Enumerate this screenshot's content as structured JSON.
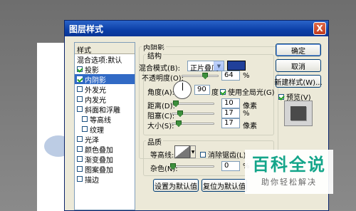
{
  "dialog": {
    "title": "图层样式",
    "close_glyph": "X"
  },
  "style_list": {
    "header": "样式",
    "items": [
      {
        "label": "混合选项:默认",
        "checkbox": false,
        "indent": false,
        "selected": false
      },
      {
        "label": "投影",
        "checkbox": true,
        "checked": true,
        "indent": false,
        "selected": false
      },
      {
        "label": "内阴影",
        "checkbox": true,
        "checked": true,
        "indent": false,
        "selected": true
      },
      {
        "label": "外发光",
        "checkbox": true,
        "checked": false,
        "indent": false,
        "selected": false
      },
      {
        "label": "内发光",
        "checkbox": true,
        "checked": false,
        "indent": false,
        "selected": false
      },
      {
        "label": "斜面和浮雕",
        "checkbox": true,
        "checked": false,
        "indent": false,
        "selected": false
      },
      {
        "label": "等高线",
        "checkbox": true,
        "checked": false,
        "indent": true,
        "selected": false
      },
      {
        "label": "纹理",
        "checkbox": true,
        "checked": false,
        "indent": true,
        "selected": false
      },
      {
        "label": "光泽",
        "checkbox": true,
        "checked": false,
        "indent": false,
        "selected": false
      },
      {
        "label": "颜色叠加",
        "checkbox": true,
        "checked": false,
        "indent": false,
        "selected": false
      },
      {
        "label": "渐变叠加",
        "checkbox": true,
        "checked": false,
        "indent": false,
        "selected": false
      },
      {
        "label": "图案叠加",
        "checkbox": true,
        "checked": false,
        "indent": false,
        "selected": false
      },
      {
        "label": "描边",
        "checkbox": true,
        "checked": false,
        "indent": false,
        "selected": false
      }
    ]
  },
  "inner_shadow": {
    "section_title": "内阴影",
    "structure": {
      "title": "结构",
      "blend_mode_label": "混合模式(B):",
      "blend_mode_value": "正片叠底",
      "blend_color": "#21409a",
      "opacity_label": "不透明度(O):",
      "opacity_value": "64",
      "opacity_level": 0.64,
      "opacity_unit": "%",
      "angle_label": "角度(A):",
      "angle_value": "90",
      "angle_unit": "度",
      "global_light_label": "使用全局光(G)",
      "global_light_checked": true,
      "distance_label": "距离(D):",
      "distance_value": "10",
      "distance_unit": "像素",
      "choke_label": "阻塞(C):",
      "choke_value": "17",
      "choke_unit": "%",
      "size_label": "大小(S):",
      "size_value": "17",
      "size_unit": "像素"
    },
    "quality": {
      "title": "品质",
      "contour_label": "等高线:",
      "anti_alias_label": "消除锯齿(L)",
      "anti_alias_checked": false,
      "noise_label": "杂色(N):",
      "noise_value": "0",
      "noise_unit": "%"
    },
    "set_default_label": "设置为默认值",
    "reset_default_label": "复位为默认值"
  },
  "side_buttons": {
    "ok": "确定",
    "cancel": "取消",
    "new_style": "新建样式(W)...",
    "preview_label": "预览(V)",
    "preview_checked": true
  },
  "watermark": {
    "logo": "百科全说",
    "subtitle": "助你轻松解决"
  }
}
